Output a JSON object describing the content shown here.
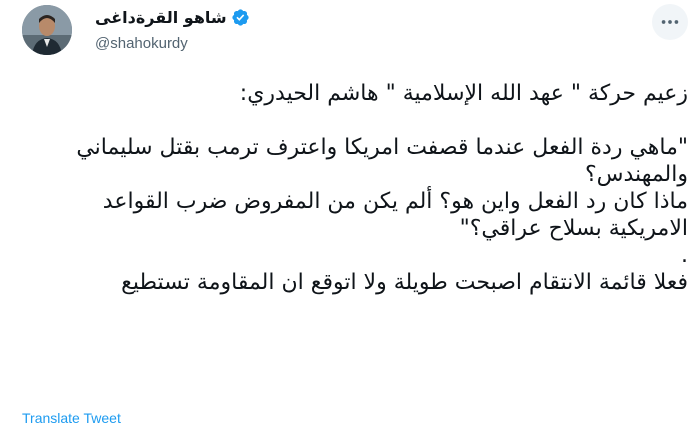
{
  "author": {
    "display_name": "شاهو القرةداغى",
    "handle": "@shahokurdy",
    "verified": true,
    "avatar_icon": "person-photo-avatar"
  },
  "tweet": {
    "paragraphs": [
      "زعيم حركة \" عهد الله الإسلامية \" هاشم الحيدري:",
      "\"ماهي ردة الفعل عندما قصفت امريكا واعترف ترمب بقتل سليماني والمهندس؟\nماذا كان رد الفعل واين هو؟ ألم يكن من المفروض ضرب القواعد الامريكية بسلاح عراقي؟\"\n.",
      "فعلا قائمة الانتقام اصبحت طويلة ولا اتوقع ان المقاومة تستطيع"
    ]
  },
  "actions": {
    "translate_label": "Translate Tweet",
    "more_icon": "more-horizontal-icon"
  },
  "colors": {
    "accent": "#1d9bf0",
    "text": "#0f1419",
    "secondary_text": "#536471"
  }
}
